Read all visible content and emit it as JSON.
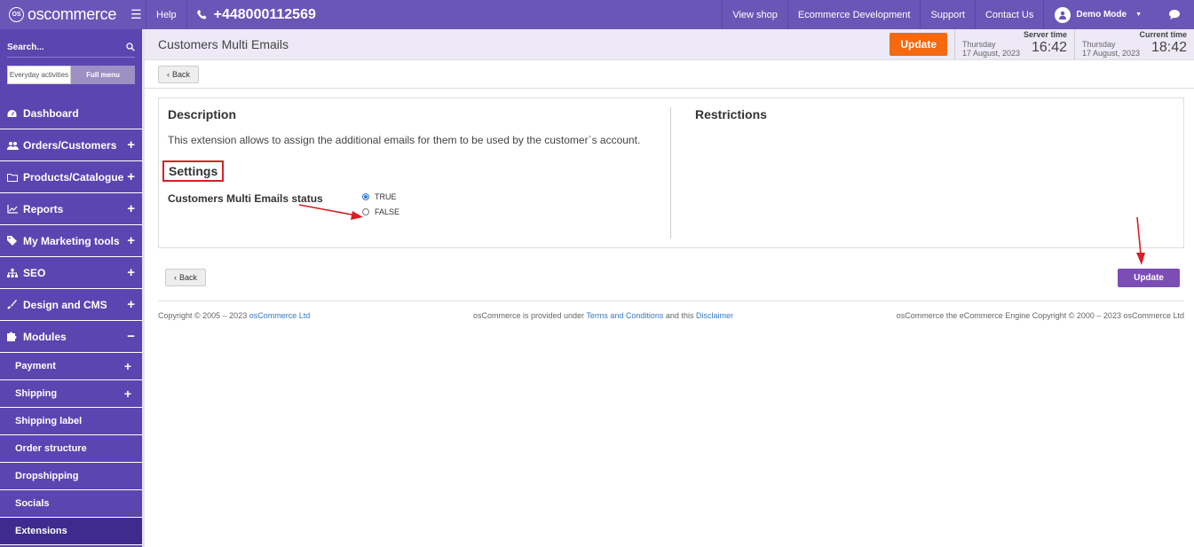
{
  "topbar": {
    "logo_text": "oscommerce",
    "logo_badge": "OS",
    "help": "Help",
    "phone": "+448000112569",
    "links": [
      "View shop",
      "Ecommerce Development",
      "Support",
      "Contact Us"
    ],
    "user": "Demo Mode"
  },
  "sidebar": {
    "search_placeholder": "Search...",
    "toggle": [
      "Everyday activities",
      "Full menu"
    ],
    "items": [
      {
        "label": "Dashboard",
        "icon": "dashboard-icon"
      },
      {
        "label": "Orders/Customers",
        "icon": "users-icon"
      },
      {
        "label": "Products/Catalogue",
        "icon": "folder-icon"
      },
      {
        "label": "Reports",
        "icon": "chart-icon"
      },
      {
        "label": "My Marketing tools",
        "icon": "tag-icon"
      },
      {
        "label": "SEO",
        "icon": "sitemap-icon"
      },
      {
        "label": "Design and CMS",
        "icon": "brush-icon"
      },
      {
        "label": "Modules",
        "icon": "puzzle-icon"
      }
    ],
    "subitems": [
      "Payment",
      "Shipping",
      "Shipping label",
      "Order structure",
      "Dropshipping",
      "Socials",
      "Extensions"
    ]
  },
  "header": {
    "title": "Customers Multi Emails",
    "update": "Update",
    "server_label": "Server time",
    "current_label": "Current time",
    "day": "Thursday",
    "date": "17 August, 2023",
    "server_time": "16:42",
    "current_time": "18:42"
  },
  "back_label": "Back",
  "panel": {
    "description_title": "Description",
    "description": "This extension allows to assign the additional emails for them to be used by the customer`s account.",
    "settings_title": "Settings",
    "status_label": "Customers Multi Emails status",
    "option_true": "TRUE",
    "option_false": "FALSE",
    "restrictions_title": "Restrictions"
  },
  "update_button": "Update",
  "footer": {
    "copyright": "Copyright © 2005 – 2023",
    "company_link": "osCommerce Ltd",
    "provided": "osCommerce is provided under",
    "terms": "Terms and Conditions",
    "and_this": "and this",
    "disclaimer": "Disclaimer",
    "engine": "osCommerce the eCommerce Engine Copyright © 2000 – 2023 osCommerce Ltd"
  },
  "colors": {
    "topbar": "#6a56b6",
    "sidebar": "#5b45b0",
    "accent_orange": "#f36a10",
    "update_purple": "#7d4db6",
    "annotation_red": "#d81f26"
  }
}
